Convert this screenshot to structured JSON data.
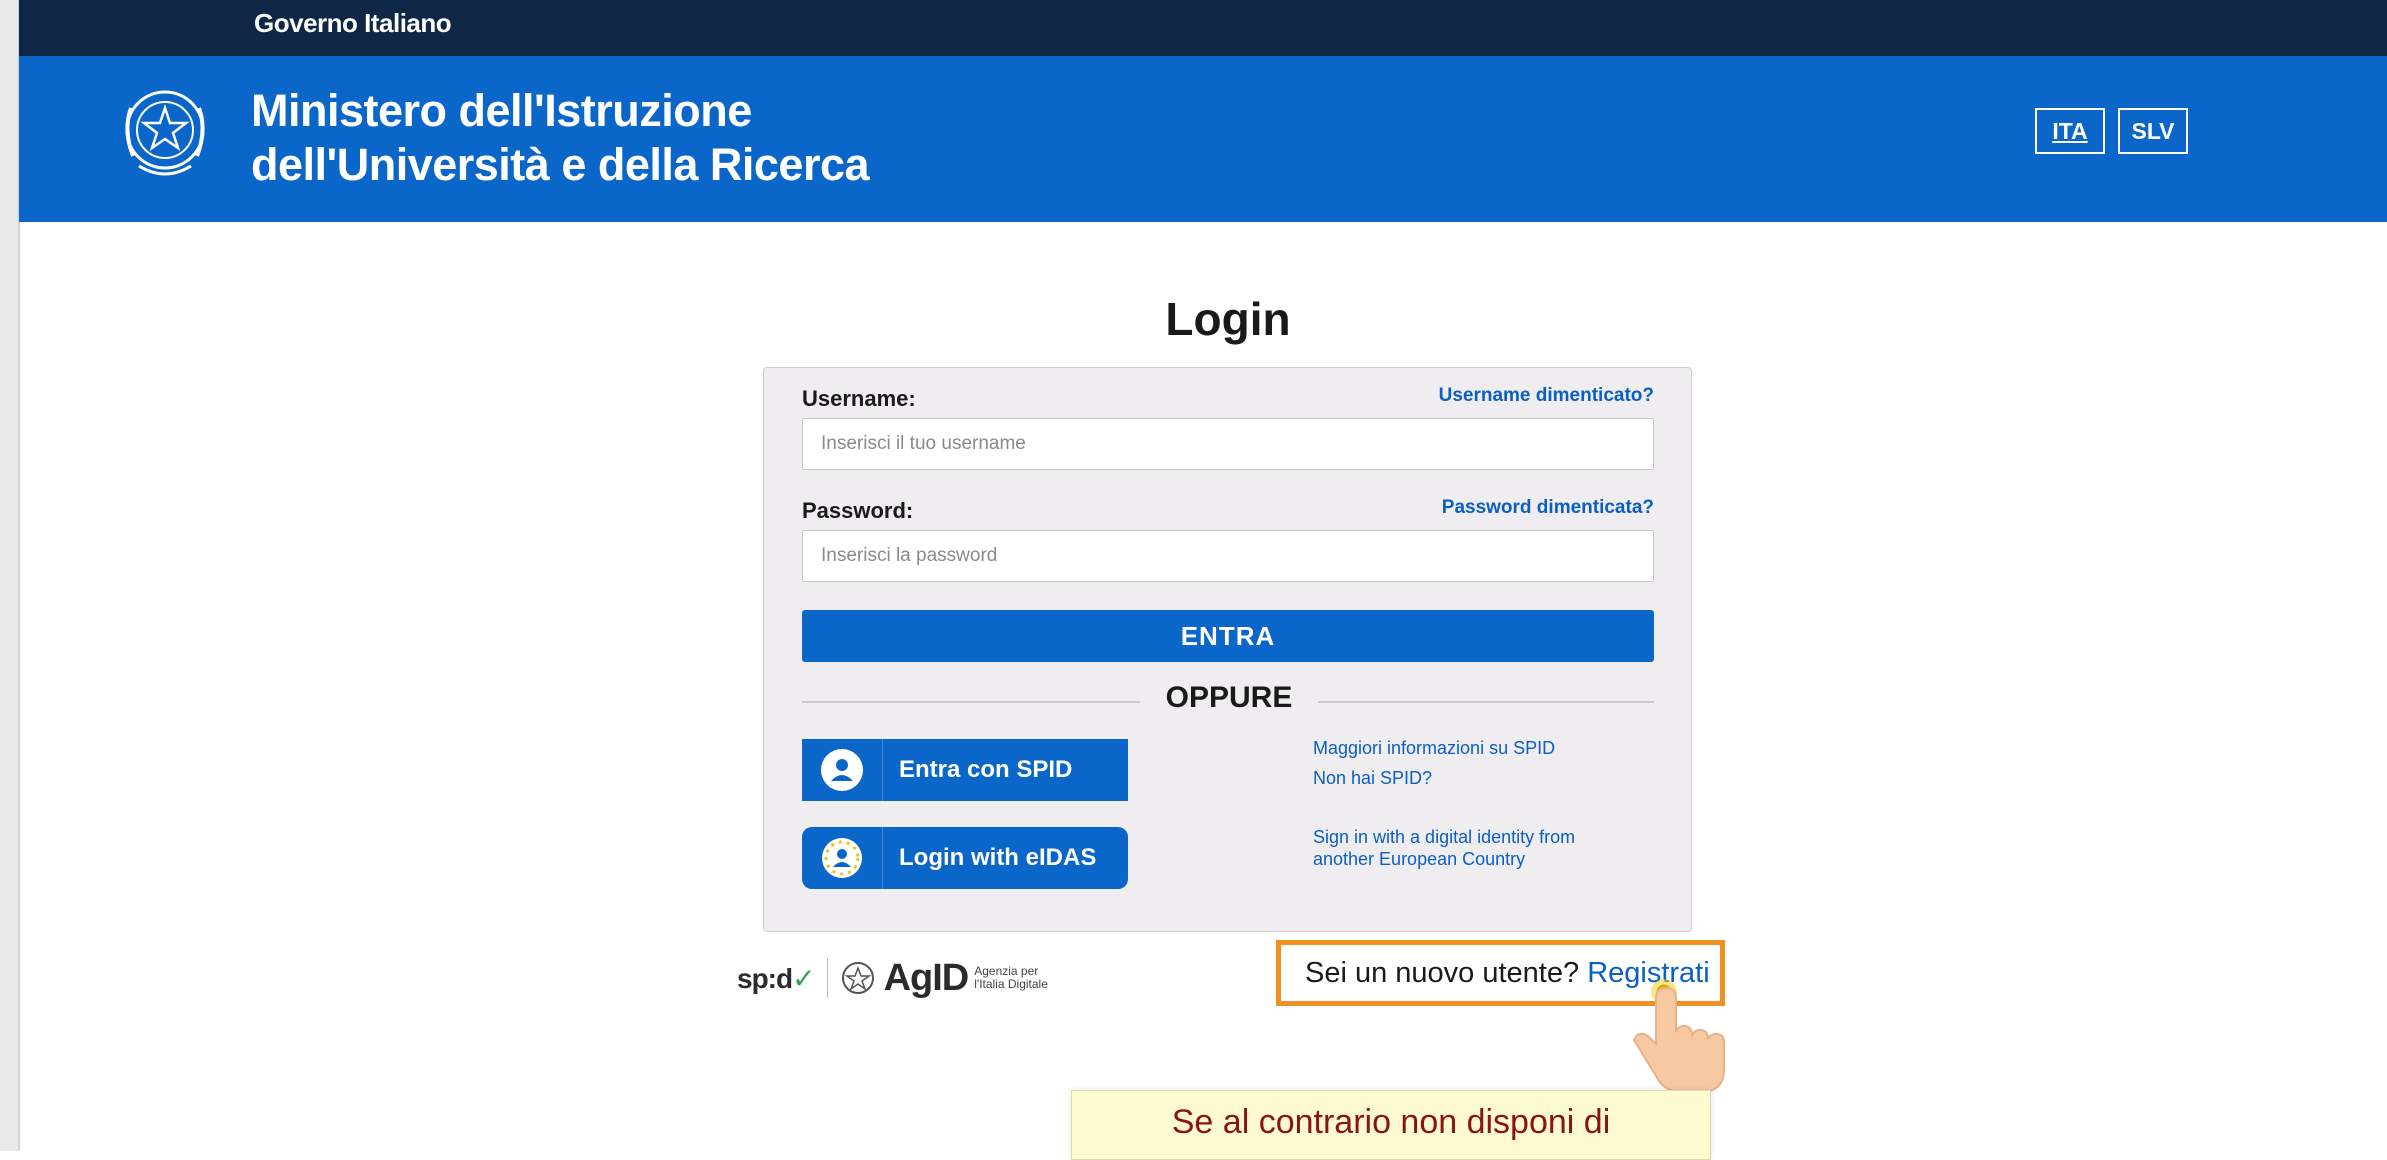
{
  "topbar": {
    "title": "Governo Italiano"
  },
  "header": {
    "title_line1": "Ministero dell'Istruzione",
    "title_line2": "dell'Università e della Ricerca",
    "languages": [
      "ITA",
      "SLV"
    ],
    "active_language": "ITA"
  },
  "login": {
    "title": "Login",
    "username_label": "Username:",
    "username_forgot": "Username dimenticato?",
    "username_placeholder": "Inserisci il tuo username",
    "username_value": "",
    "password_label": "Password:",
    "password_forgot": "Password dimenticata?",
    "password_placeholder": "Inserisci la password",
    "password_value": "",
    "enter_button": "ENTRA",
    "divider": "OPPURE",
    "spid_button": "Entra con SPID",
    "spid_info": "Maggiori informazioni su SPID",
    "spid_missing": "Non hai SPID?",
    "eidas_button": "Login with eIDAS",
    "eidas_info_line1": "Sign in with a digital identity from",
    "eidas_info_line2": "another European Country"
  },
  "footer_logos": {
    "spid": "sp:d",
    "agid": "AgID",
    "agid_sub_line1": "Agenzia per",
    "agid_sub_line2": "l'Italia Digitale"
  },
  "register": {
    "question": "Sei un nuovo utente?",
    "link": "Registrati"
  },
  "tooltip": {
    "text": "Se al contrario non disponi di"
  },
  "colors": {
    "header_blue": "#0b66c9",
    "topbar_navy": "#0f2746",
    "highlight_orange": "#f08f22",
    "tooltip_bg": "#fffbd1"
  }
}
